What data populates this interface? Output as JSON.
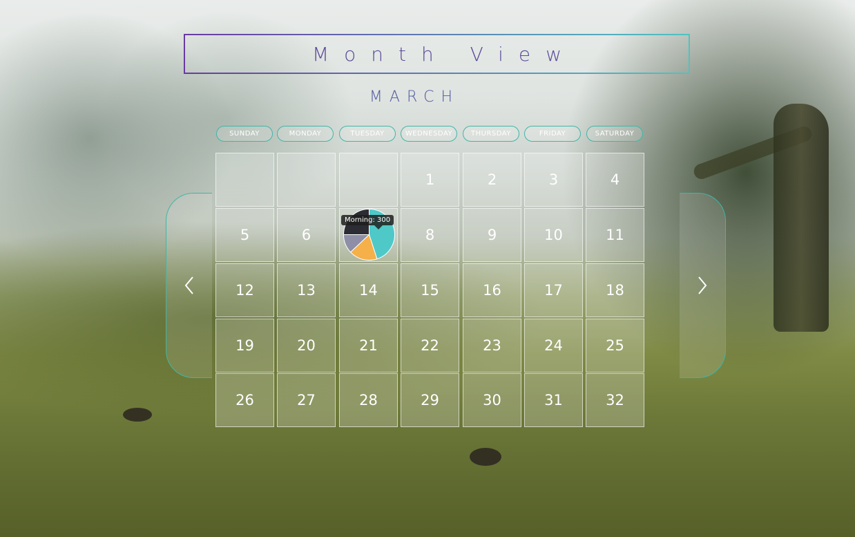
{
  "header": {
    "title": "Month View"
  },
  "calendar": {
    "month": "MARCH",
    "weekdays": [
      "SUNDAY",
      "MONDAY",
      "TUESDAY",
      "WEDNESDAY",
      "THURSDAY",
      "FRIDAY",
      "SATURDAY"
    ],
    "weeks": [
      [
        "",
        "",
        "",
        "1",
        "2",
        "3",
        "4"
      ],
      [
        "5",
        "6",
        "",
        "8",
        "9",
        "10",
        "11"
      ],
      [
        "12",
        "13",
        "14",
        "15",
        "16",
        "17",
        "18"
      ],
      [
        "19",
        "20",
        "21",
        "22",
        "23",
        "24",
        "25"
      ],
      [
        "26",
        "27",
        "28",
        "29",
        "30",
        "31",
        "32"
      ]
    ]
  },
  "nav": {
    "prev_icon": "chevron-left-icon",
    "next_icon": "chevron-right-icon"
  },
  "day_chart": {
    "tooltip": "Morning: 300",
    "colors": [
      "#4fc8c8",
      "#f5b04a",
      "#8e8ea6",
      "#2c2c34"
    ]
  },
  "chart_data": {
    "type": "pie",
    "title": "",
    "slices": [
      {
        "name": "Morning",
        "value": 300
      }
    ]
  }
}
